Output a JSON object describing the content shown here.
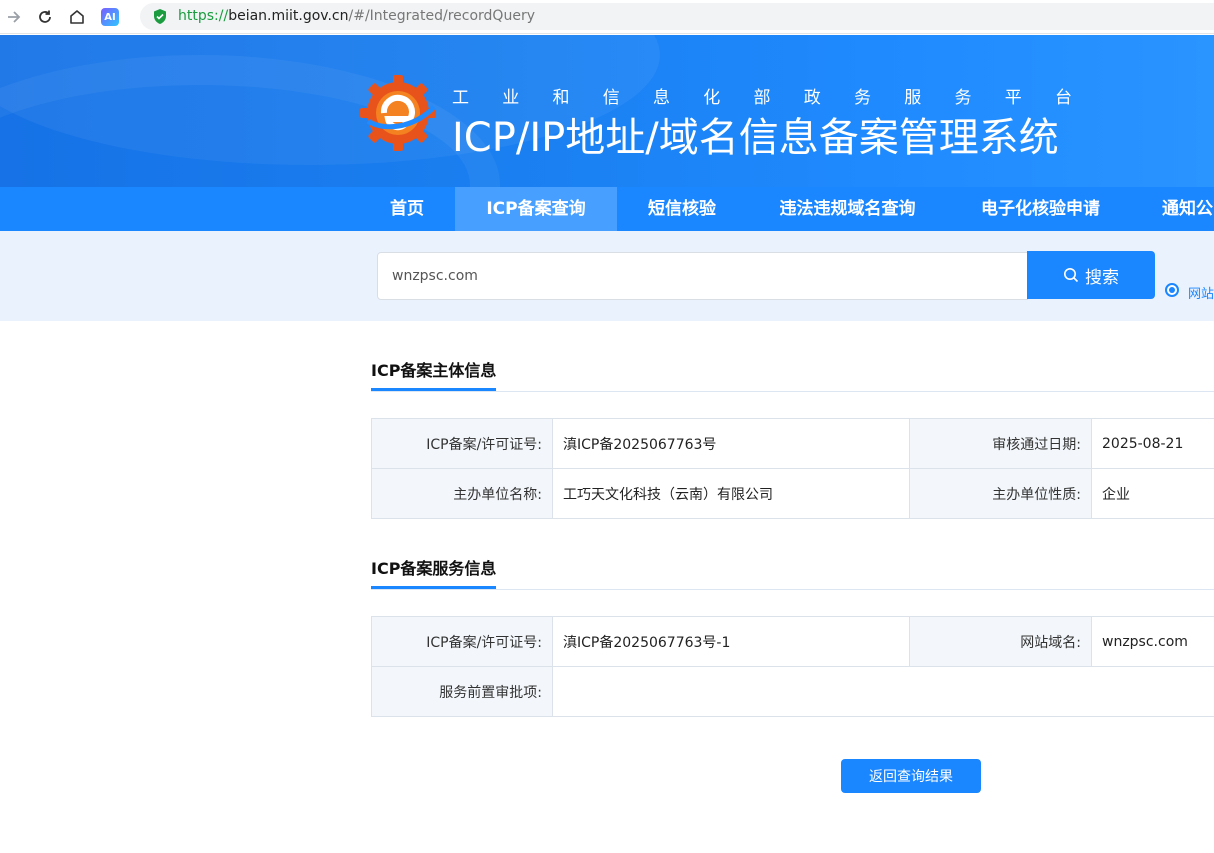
{
  "browser": {
    "url_scheme": "https://",
    "url_host": "beian.miit.gov.cn",
    "url_path": "/#/Integrated/recordQuery",
    "ai_label": "AI"
  },
  "header": {
    "platform_chars": [
      "工",
      "业",
      "和",
      "信",
      "息",
      "化",
      "部",
      "政",
      "务",
      "服",
      "务",
      "平",
      "台"
    ],
    "system_title": "ICP/IP地址/域名信息备案管理系统"
  },
  "nav": {
    "items": [
      {
        "label": "首页"
      },
      {
        "label": "ICP备案查询",
        "active": true
      },
      {
        "label": "短信核验"
      },
      {
        "label": "违法违规域名查询"
      },
      {
        "label": "电子化核验申请"
      },
      {
        "label": "通知公"
      }
    ]
  },
  "search": {
    "value": "wnzpsc.com",
    "button_label": "搜索",
    "radio_label": "网站"
  },
  "entity_section": {
    "title": "ICP备案主体信息",
    "rows": [
      {
        "label1": "ICP备案/许可证号:",
        "value1": "滇ICP备2025067763号",
        "label2": "审核通过日期:",
        "value2": "2025-08-21"
      },
      {
        "label1": "主办单位名称:",
        "value1": "工巧天文化科技（云南）有限公司",
        "label2": "主办单位性质:",
        "value2": "企业"
      }
    ]
  },
  "service_section": {
    "title": "ICP备案服务信息",
    "rows": [
      {
        "label1": "ICP备案/许可证号:",
        "value1": "滇ICP备2025067763号-1",
        "label2": "网站域名:",
        "value2": "wnzpsc.com"
      },
      {
        "label1": "服务前置审批项:",
        "value1": ""
      }
    ]
  },
  "back_button": "返回查询结果",
  "colors": {
    "primary": "#1a86ff",
    "nav_active": "#47a0ff",
    "search_band": "#eaf3fd"
  }
}
